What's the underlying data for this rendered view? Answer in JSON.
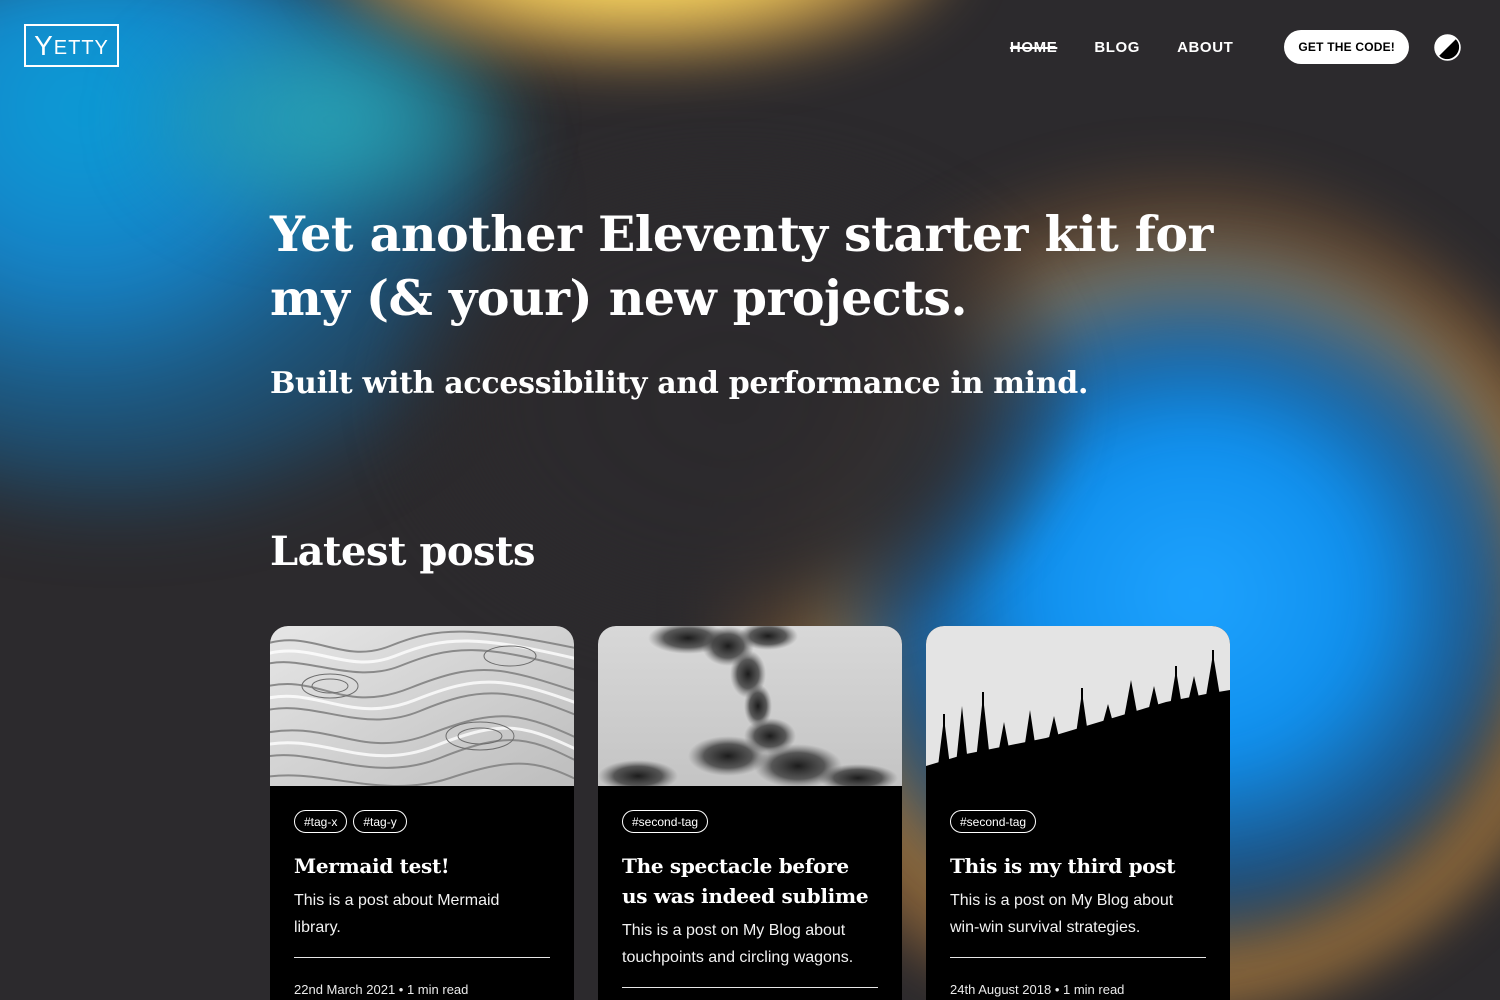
{
  "header": {
    "logo_first": "Y",
    "logo_rest": "ETTY",
    "nav": [
      {
        "label": "HOME",
        "current": true
      },
      {
        "label": "BLOG",
        "current": false
      },
      {
        "label": "ABOUT",
        "current": false
      }
    ],
    "cta_label": "GET THE CODE!",
    "theme_toggle_icon": "contrast-icon"
  },
  "hero": {
    "title": "Yet another Eleventy starter kit for my (& your) new projects.",
    "subtitle": "Built with accessibility and performance in mind."
  },
  "latest": {
    "heading": "Latest posts",
    "posts": [
      {
        "tags": [
          "#tag-x",
          "#tag-y"
        ],
        "title": "Mermaid test!",
        "description": "This is a post about Mermaid library.",
        "date": "22nd March 2021",
        "read_time": "1 min read",
        "image": "paper-folds-image"
      },
      {
        "tags": [
          "#second-tag"
        ],
        "title": "The spectacle before us was indeed sublime",
        "description": "This is a post on My Blog about touchpoints and circling wagons.",
        "date": "",
        "read_time": "",
        "image": "ink-smoke-image"
      },
      {
        "tags": [
          "#second-tag"
        ],
        "title": "This is my third post",
        "description": "This is a post on My Blog about win-win survival strategies.",
        "date": "24th August 2018",
        "read_time": "1 min read",
        "image": "forest-silhouette-image"
      }
    ]
  },
  "colors": {
    "background": "#2c2a2d",
    "card": "#000000",
    "text": "#ffffff",
    "accent_blue": "#1ea3ff",
    "accent_yellow": "#ffe36a",
    "accent_orange": "#d2964a"
  }
}
